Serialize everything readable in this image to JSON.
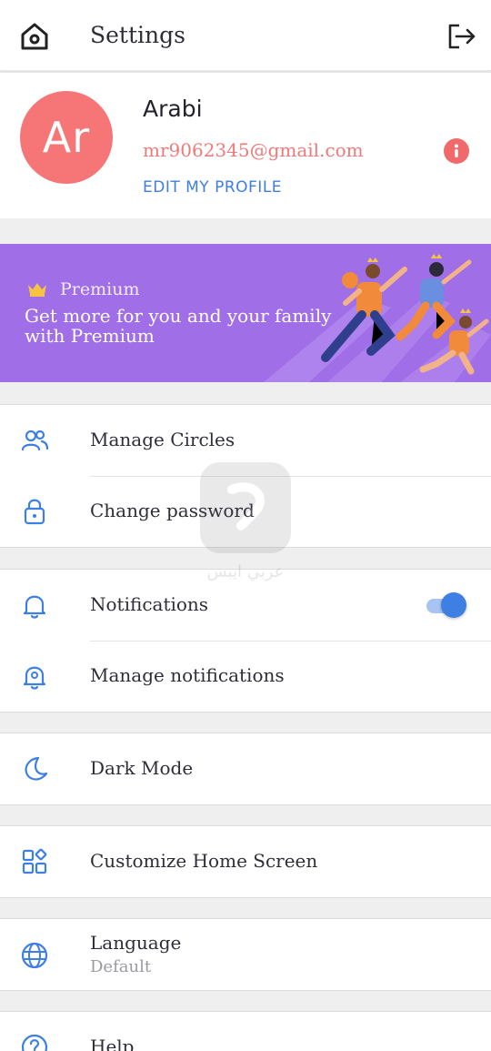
{
  "header": {
    "title": "Settings",
    "home_icon": "home-icon",
    "logout_icon": "logout-icon"
  },
  "profile": {
    "initials": "Ar",
    "name": "Arabi",
    "email": "mr9062345@gmail.com",
    "edit_label": "EDIT MY PROFILE",
    "info_icon": "info-icon",
    "avatar_color": "#f67576"
  },
  "premium": {
    "label": "Premium",
    "tagline_line1": "Get more for you and your family",
    "tagline_line2": "with Premium",
    "background": "#a06ee6"
  },
  "groups": {
    "account": {
      "manage_circles": "Manage Circles",
      "change_password": "Change password"
    },
    "notify": {
      "notifications": "Notifications",
      "notifications_enabled": true,
      "manage_notifications": "Manage notifications"
    },
    "dark_mode": "Dark Mode",
    "customize_home": "Customize Home Screen",
    "language": {
      "label": "Language",
      "value": "Default"
    },
    "help": "Help"
  },
  "watermark": {
    "text": "عربي ايبس"
  },
  "colors": {
    "accent": "#3e7fe3",
    "danger": "#f06a6c"
  }
}
